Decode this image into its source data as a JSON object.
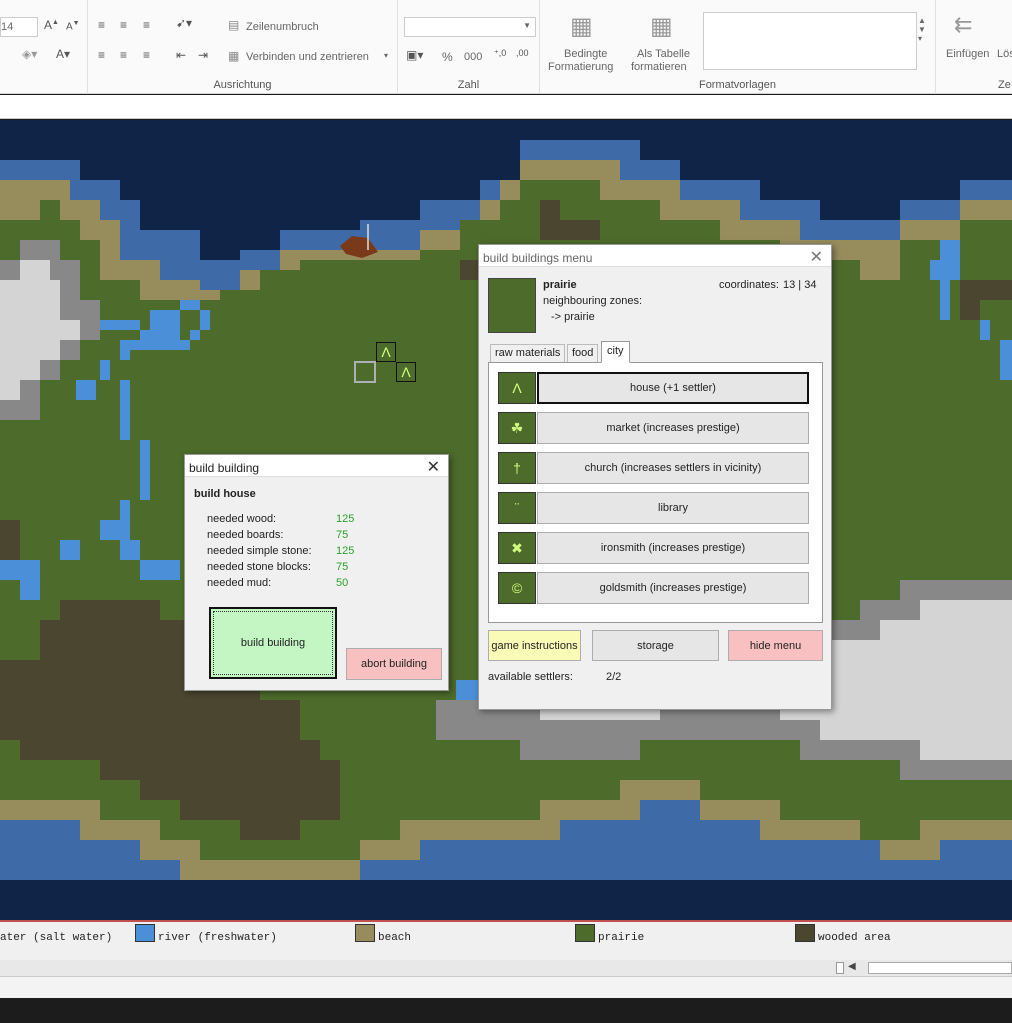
{
  "ribbon": {
    "font_size": "14",
    "wrap_text": "Zeilenumbruch",
    "merge_center": "Verbinden und zentrieren",
    "group_alignment": "Ausrichtung",
    "group_number": "Zahl",
    "percent": "%",
    "thousands": "000",
    "cond_format_1": "Bedingte",
    "cond_format_2": "Formatierung",
    "as_table_1": "Als Tabelle",
    "as_table_2": "formatieren",
    "group_styles": "Formatvorlagen",
    "insert": "Einfügen",
    "delete": "Lös",
    "group_cells": "Ze"
  },
  "legend": [
    {
      "label": "ater (salt water)",
      "color": "#0f2446"
    },
    {
      "label": "river (freshwater)",
      "color": "#4a8fd8"
    },
    {
      "label": "beach",
      "color": "#968c5c"
    },
    {
      "label": "prairie",
      "color": "#4d6b2a"
    },
    {
      "label": "wooded area",
      "color": "#4b4630"
    }
  ],
  "menu": {
    "title": "build buildings menu",
    "zone_name": "prairie",
    "coordinates_label": "coordinates:",
    "coordinates_value": "13 | 34",
    "neighbour_label": "neighbouring zones:",
    "neighbour_value": "-> prairie",
    "tabs": [
      "raw materials",
      "food",
      "city"
    ],
    "buildings": [
      {
        "icon": "Λ",
        "label": "house (+1 settler)"
      },
      {
        "icon": "☘",
        "label": "market (increases prestige)"
      },
      {
        "icon": "†",
        "label": "church (increases settlers in vicinity)"
      },
      {
        "icon": "¨",
        "label": "library"
      },
      {
        "icon": "✖",
        "label": "ironsmith (increases prestige)"
      },
      {
        "icon": "©",
        "label": "goldsmith (increases prestige)"
      }
    ],
    "instructions_label": "game instructions",
    "storage_label": "storage",
    "hide_label": "hide menu",
    "settlers_label": "available settlers:",
    "settlers_value": "2/2"
  },
  "build": {
    "title": "build building",
    "heading": "build house",
    "requirements": [
      {
        "label": "needed wood:",
        "value": "125"
      },
      {
        "label": "needed boards:",
        "value": "75"
      },
      {
        "label": "needed simple stone:",
        "value": "125"
      },
      {
        "label": "needed stone blocks:",
        "value": "75"
      },
      {
        "label": "needed mud:",
        "value": "50"
      }
    ],
    "build_label": "build building",
    "abort_label": "abort building"
  },
  "map_markers": {
    "house_icon": "Λ"
  },
  "colors": {
    "deep_water": "#0f2446",
    "river": "#4a8fd8",
    "shallow": "#3f6aa8",
    "beach": "#968c5c",
    "prairie": "#4d6b2a",
    "wooded": "#4b4630",
    "mountain": "#888888",
    "snow": "#d4d4d4"
  }
}
